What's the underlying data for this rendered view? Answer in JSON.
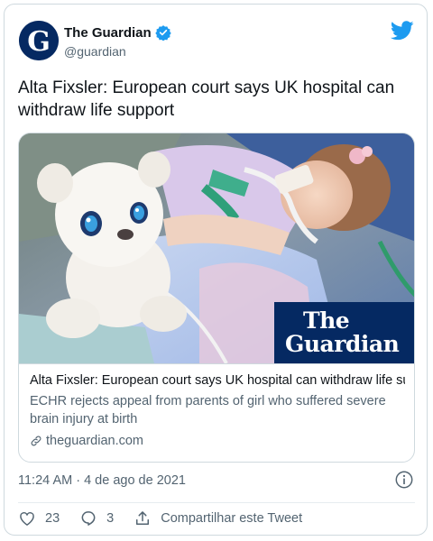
{
  "author": {
    "name": "The Guardian",
    "handle": "@guardian",
    "avatar_letter": "G",
    "verified": true
  },
  "tweet": {
    "text": "Alta Fixsler: European court says UK hospital can withdraw life support"
  },
  "card": {
    "image_brand_line1": "The",
    "image_brand_line2": "Guardian",
    "title": "Alta Fixsler: European court says UK hospital can withdraw life su...",
    "description": "ECHR rejects appeal from parents of girl who suffered severe brain injury at birth",
    "domain": "theguardian.com"
  },
  "meta": {
    "timestamp": "11:24 AM · 4 de ago de 2021"
  },
  "actions": {
    "likes": "23",
    "replies": "3",
    "share_label": "Compartilhar este Tweet"
  },
  "colors": {
    "twitter_blue": "#1d9bf0",
    "guardian_navy": "#052962",
    "secondary_text": "#536471"
  },
  "icons": [
    "twitter-bird-icon",
    "verified-badge-icon",
    "link-icon",
    "info-icon",
    "heart-icon",
    "reply-icon",
    "share-icon"
  ]
}
